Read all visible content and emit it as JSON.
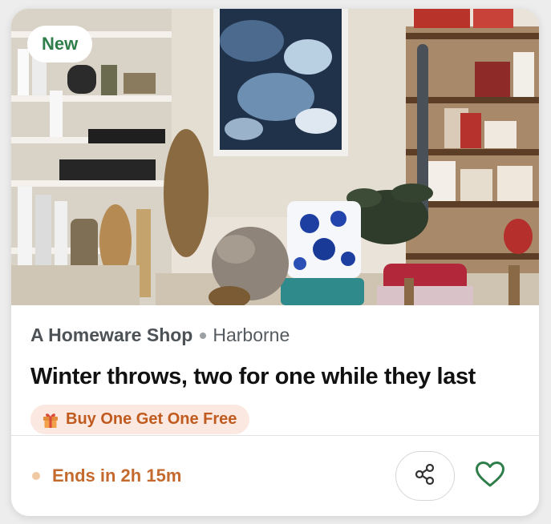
{
  "card": {
    "badge": "New",
    "shop_name": "A Homeware Shop",
    "location": "Harborne",
    "title": "Winter throws, two for one while they last",
    "offer_label": "Buy One Get One Free",
    "ends_text": "Ends in 2h 15m",
    "photo_icon": "shop-interior-photo",
    "gift_icon": "gift-icon",
    "share_icon": "share-icon",
    "favorite_icon": "heart-outline-icon"
  },
  "colors": {
    "badge_text": "#2f7d4a",
    "offer_text": "#c05a1e",
    "offer_bg": "#fbe8e0",
    "ends_text": "#c56a2e",
    "heart": "#2f7d4a"
  }
}
